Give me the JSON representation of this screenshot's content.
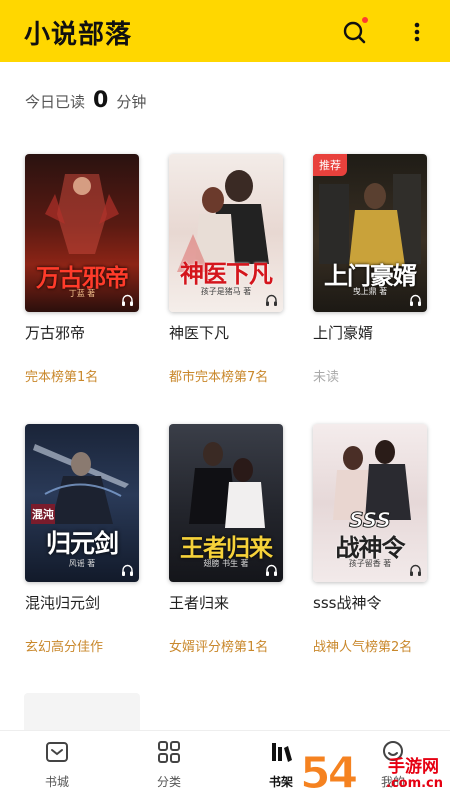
{
  "header": {
    "title": "小说部落",
    "search_icon": "search-icon",
    "more_icon": "more-vertical-icon",
    "accent": "#ffd700"
  },
  "today": {
    "prefix": "今日已读",
    "minutes": "0",
    "suffix": "分钟"
  },
  "books": [
    {
      "title": "万古邪帝",
      "rank": "完本榜第1名",
      "cover_title": "万古邪帝",
      "cover_sub": "丁蓝 著",
      "badge": ""
    },
    {
      "title": "神医下凡",
      "rank": "都市完本榜第7名",
      "cover_title": "神医下凡",
      "cover_sub": "孩子是猪马 著",
      "badge": ""
    },
    {
      "title": "上门豪婿",
      "rank": "未读",
      "cover_title": "上门豪婿",
      "cover_sub": "曳上鼎 著",
      "badge": "推荐"
    },
    {
      "title": "混沌归元剑",
      "rank": "玄幻高分佳作",
      "cover_title": "归元剑",
      "cover_kicker": "混沌",
      "cover_sub": "风谣 著",
      "badge": ""
    },
    {
      "title": "王者归来",
      "rank": "女婿评分榜第1名",
      "cover_title": "王者归来",
      "cover_sub": "翅膀 书生 著",
      "badge": ""
    },
    {
      "title": "sss战神令",
      "rank": "战神人气榜第2名",
      "cover_title": "战神令",
      "cover_kicker": "SSS",
      "cover_sub": "孩子留香 著",
      "badge": ""
    }
  ],
  "tabs": [
    {
      "label": "书城",
      "icon": "bookstore-icon",
      "active": false
    },
    {
      "label": "分类",
      "icon": "category-grid-icon",
      "active": false
    },
    {
      "label": "书架",
      "icon": "bookshelf-icon",
      "active": true
    },
    {
      "label": "我的",
      "icon": "profile-icon",
      "active": false
    }
  ],
  "watermark": {
    "number": "54",
    "brand": "手游网",
    "domain": ".com.cn",
    "color": "#f58220"
  }
}
